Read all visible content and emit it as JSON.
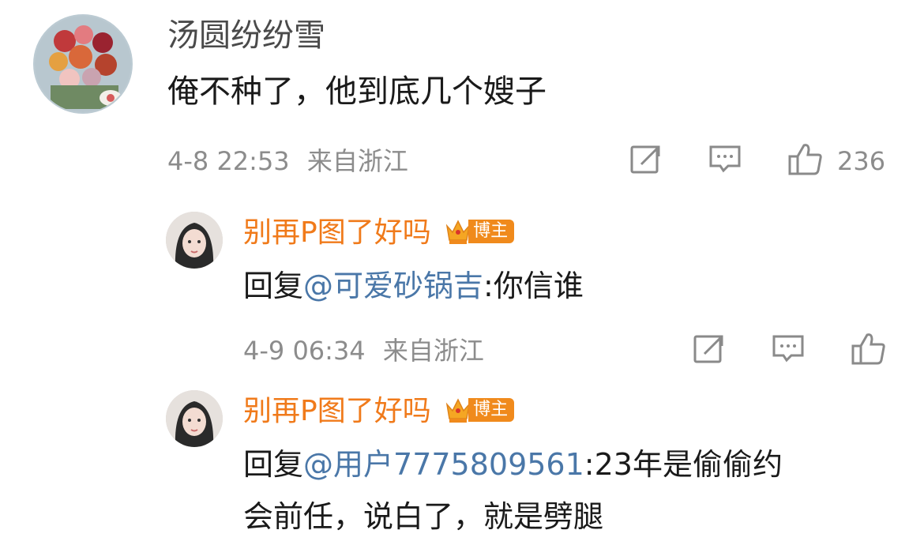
{
  "comment": {
    "author": "汤圆纷纷雪",
    "text": "俺不种了，他到底几个嫂子",
    "time": "4-8 22:53",
    "location": "来自浙江",
    "like_count": "236",
    "icons": [
      "share-icon",
      "comment-icon",
      "like-icon"
    ]
  },
  "replies": [
    {
      "author": "别再P图了好吗",
      "badge": "博主",
      "prefix": "回复",
      "mention": "@可爱砂锅吉",
      "text": ":你信谁",
      "time": "4-9 06:34",
      "location": "来自浙江"
    },
    {
      "author": "别再P图了好吗",
      "badge": "博主",
      "prefix": "回复",
      "mention": "@用户7775809561",
      "text_line1": ":23年是偷偷约",
      "text_line2": "会前任，说白了，就是劈腿"
    }
  ],
  "colors": {
    "username": "#f07a1a",
    "mention": "#4a77a8",
    "meta": "#8c8c8c",
    "badge": "#f08a1c"
  }
}
